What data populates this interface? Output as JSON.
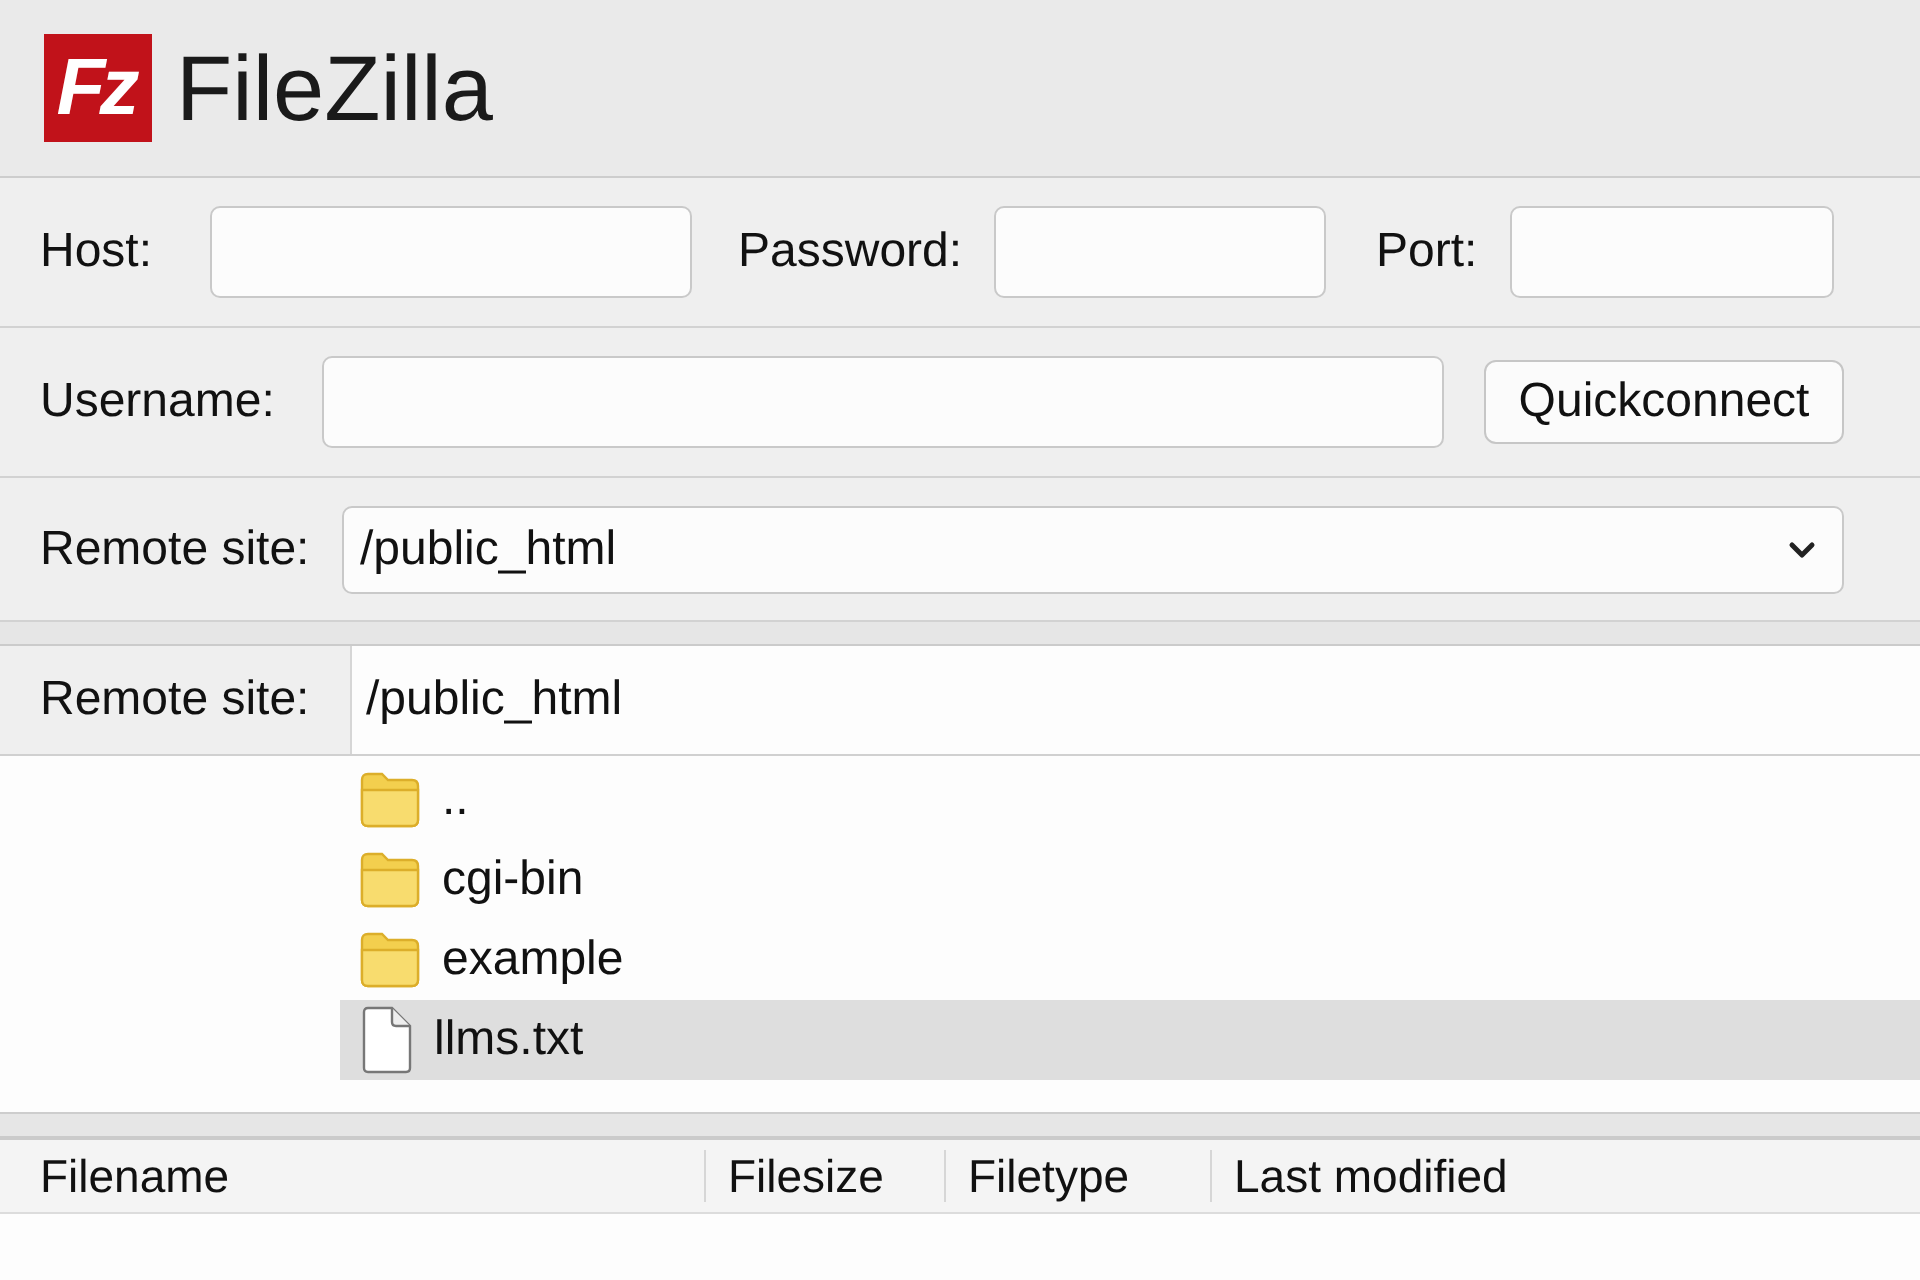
{
  "app": {
    "logo_text": "Fz",
    "title": "FileZilla"
  },
  "quickconnect": {
    "host": {
      "label": "Host:"
    },
    "password": {
      "label": "Password:"
    },
    "port": {
      "label": "Port:"
    },
    "username": {
      "label": "Username:"
    },
    "button": "Quickconnect",
    "remote_site": {
      "label": "Remote site:",
      "value": "/public_html"
    }
  },
  "remote_pane": {
    "label": "Remote site:",
    "path": "/public_html",
    "items": [
      {
        "name": "..",
        "kind": "folder",
        "selected": false
      },
      {
        "name": "cgi-bin",
        "kind": "folder",
        "selected": false
      },
      {
        "name": "example",
        "kind": "folder",
        "selected": false
      },
      {
        "name": "llms.txt",
        "kind": "file",
        "selected": true
      }
    ]
  },
  "file_list": {
    "columns": [
      "Filename",
      "Filesize",
      "Filetype",
      "Last modified"
    ]
  }
}
